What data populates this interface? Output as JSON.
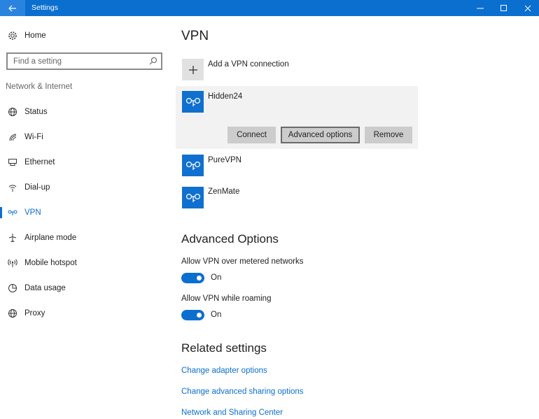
{
  "window": {
    "title": "Settings",
    "controls": [
      "minimize-icon",
      "maximize-icon",
      "close-icon"
    ]
  },
  "sidebar": {
    "home_label": "Home",
    "search_placeholder": "Find a setting",
    "section_label": "Network & Internet",
    "items": [
      {
        "label": "Status",
        "icon": "status-globe-icon",
        "active": false
      },
      {
        "label": "Wi-Fi",
        "icon": "wifi-icon",
        "active": false
      },
      {
        "label": "Ethernet",
        "icon": "ethernet-icon",
        "active": false
      },
      {
        "label": "Dial-up",
        "icon": "dialup-icon",
        "active": false
      },
      {
        "label": "VPN",
        "icon": "vpn-icon",
        "active": true
      },
      {
        "label": "Airplane mode",
        "icon": "airplane-icon",
        "active": false
      },
      {
        "label": "Mobile hotspot",
        "icon": "hotspot-icon",
        "active": false
      },
      {
        "label": "Data usage",
        "icon": "data-usage-icon",
        "active": false
      },
      {
        "label": "Proxy",
        "icon": "proxy-globe-icon",
        "active": false
      }
    ]
  },
  "main": {
    "title": "VPN",
    "add_connection_label": "Add a VPN connection",
    "connections": [
      {
        "name": "Hidden24",
        "selected": true
      },
      {
        "name": "PureVPN",
        "selected": false
      },
      {
        "name": "ZenMate",
        "selected": false
      }
    ],
    "actions": {
      "connect": "Connect",
      "advanced": "Advanced options",
      "remove": "Remove"
    },
    "advanced_options": {
      "heading": "Advanced Options",
      "metered_label": "Allow VPN over metered networks",
      "metered_state": "On",
      "roaming_label": "Allow VPN while roaming",
      "roaming_state": "On"
    },
    "related": {
      "heading": "Related settings",
      "links": [
        "Change adapter options",
        "Change advanced sharing options",
        "Network and Sharing Center"
      ]
    }
  },
  "colors": {
    "accent": "#0b6fd0",
    "titlebar": "#0b6fd0",
    "selected_bg": "#f2f2f2",
    "button_bg": "#cccccc"
  }
}
